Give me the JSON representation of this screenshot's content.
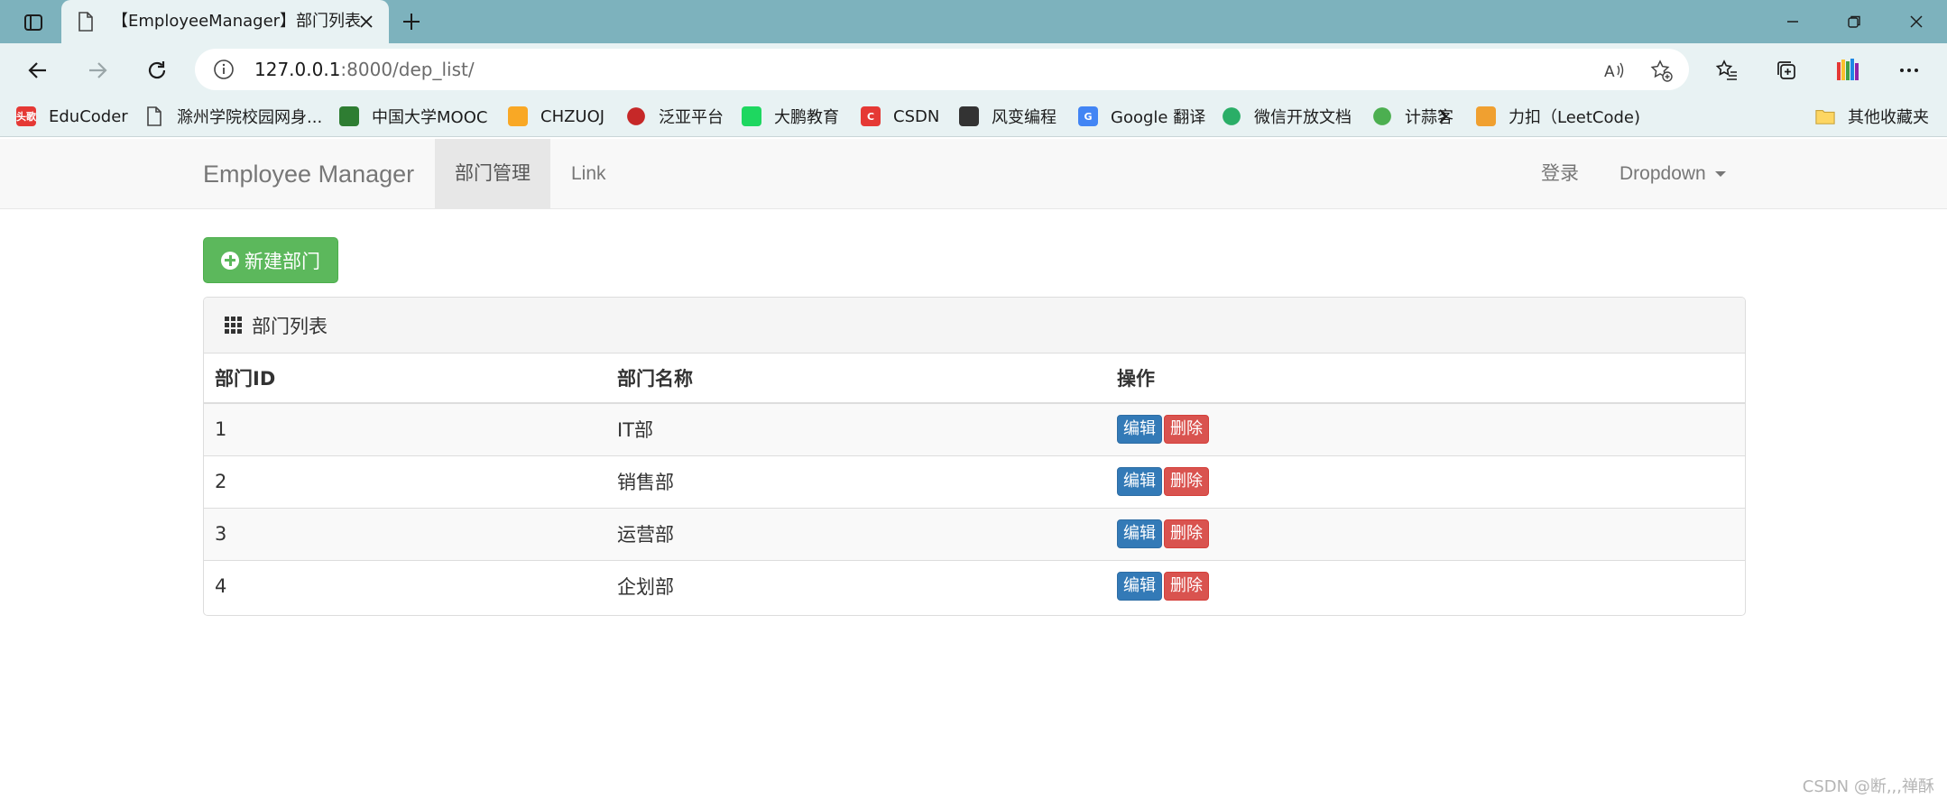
{
  "browser": {
    "tab_title": "【EmployeeManager】部门列表",
    "url_host": "127.0.0.1",
    "url_rest": ":8000/dep_list/",
    "bookmarks": [
      {
        "label": "EduCoder",
        "icon": "educoder-icon",
        "color": "#e53935",
        "badge": "头歌"
      },
      {
        "label": "滁州学院校园网身...",
        "icon": "page-icon",
        "color": "#555555",
        "badge": ""
      },
      {
        "label": "中国大学MOOC",
        "icon": "mooc-icon",
        "color": "#2e7d32",
        "badge": ""
      },
      {
        "label": "CHZUOJ",
        "icon": "chzuoj-icon",
        "color": "#f9a825",
        "badge": ""
      },
      {
        "label": "泛亚平台",
        "icon": "fanya-icon",
        "color": "#c62828",
        "badge": ""
      },
      {
        "label": "大鹏教育",
        "icon": "dapeng-icon",
        "color": "#1ed760",
        "badge": ""
      },
      {
        "label": "CSDN",
        "icon": "csdn-icon",
        "color": "#e53935",
        "badge": "C"
      },
      {
        "label": "风变编程",
        "icon": "fengbian-icon",
        "color": "#333333",
        "badge": ""
      },
      {
        "label": "Google 翻译",
        "icon": "google-translate-icon",
        "color": "#4285f4",
        "badge": "G"
      },
      {
        "label": "微信开放文档",
        "icon": "wechat-icon",
        "color": "#2aae67",
        "badge": ""
      },
      {
        "label": "计蒜客",
        "icon": "jisuanke-icon",
        "color": "#4caf50",
        "badge": ""
      },
      {
        "label": "力扣（LeetCode)",
        "icon": "leetcode-icon",
        "color": "#f0a030",
        "badge": ""
      }
    ],
    "other_bookmarks": "其他收藏夹"
  },
  "navbar": {
    "brand": "Employee Manager",
    "items": [
      "部门管理",
      "Link"
    ],
    "login": "登录",
    "dropdown": "Dropdown"
  },
  "page": {
    "new_button": "新建部门",
    "panel_title": "部门列表",
    "columns": [
      "部门ID",
      "部门名称",
      "操作"
    ],
    "rows": [
      {
        "id": "1",
        "name": "IT部"
      },
      {
        "id": "2",
        "name": "销售部"
      },
      {
        "id": "3",
        "name": "运营部"
      },
      {
        "id": "4",
        "name": "企划部"
      }
    ],
    "edit_label": "编辑",
    "delete_label": "删除"
  },
  "watermark": "CSDN @断,,,禅酥",
  "colors": {
    "success": "#5cb85c",
    "primary": "#337ab7",
    "danger": "#d9534f",
    "tabstrip": "#7db2bd"
  }
}
